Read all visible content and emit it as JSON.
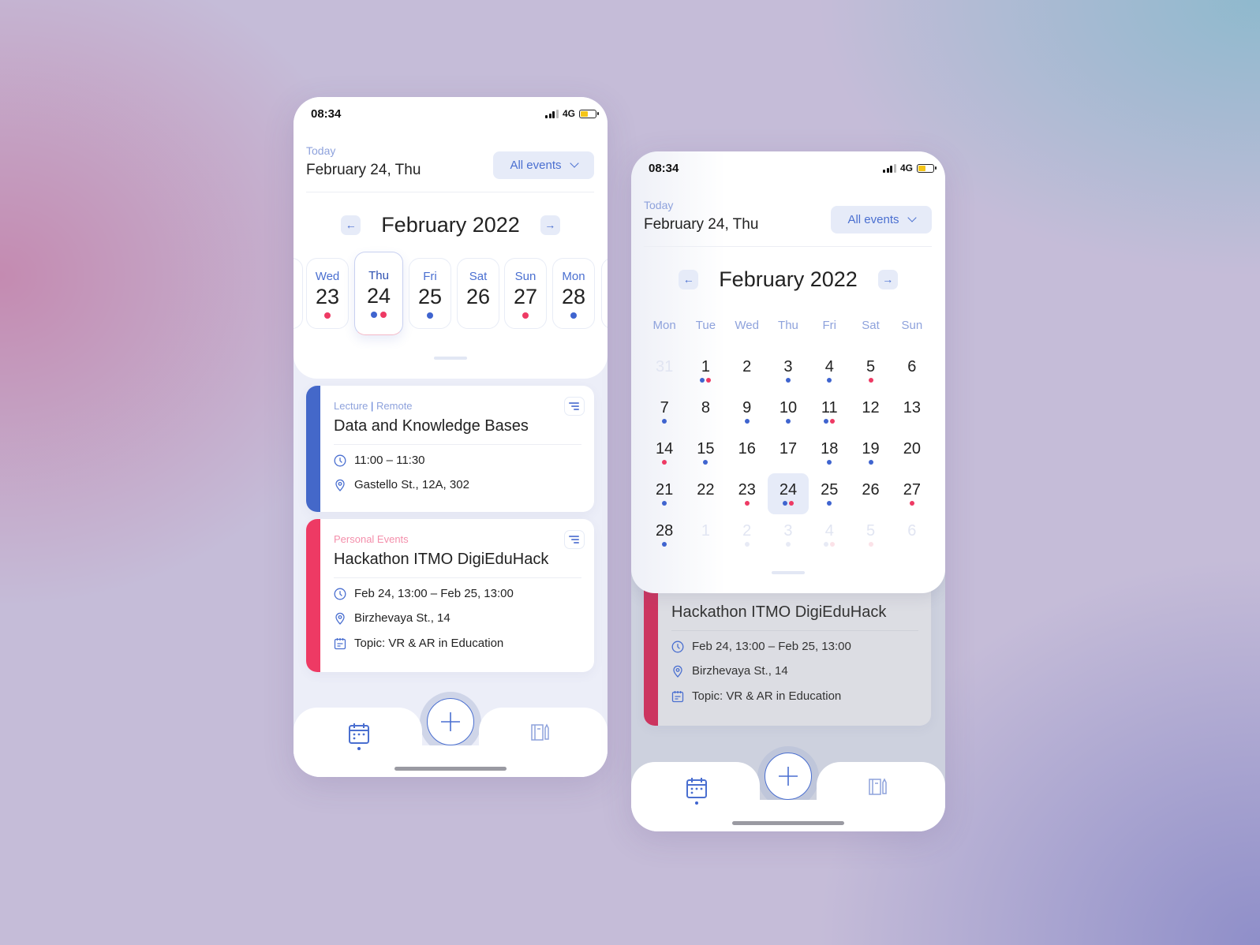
{
  "colors": {
    "accent_blue": "#3f64cf",
    "accent_red": "#ee3a64",
    "label_blue": "#8ea2dc",
    "chip_bg": "#e6ebf8",
    "battery_yellow": "#f5c518"
  },
  "status_bar": {
    "time": "08:34",
    "network": "4G",
    "signal_icon": "signal-bars-icon",
    "battery_icon": "battery-icon",
    "battery_level": 0.5
  },
  "header": {
    "today_label": "Today",
    "today_date": "February 24, Thu",
    "filter": {
      "label": "All events",
      "icon": "chevron-down-icon"
    }
  },
  "month_nav": {
    "title": "February 2022",
    "prev_icon": "arrow-left-icon",
    "next_icon": "arrow-right-icon"
  },
  "week_strip": {
    "days": [
      {
        "name": "Wed",
        "num": "23",
        "dots": [
          "red"
        ]
      },
      {
        "name": "Thu",
        "num": "24",
        "dots": [
          "blue",
          "red"
        ],
        "selected": true
      },
      {
        "name": "Fri",
        "num": "25",
        "dots": [
          "blue"
        ]
      },
      {
        "name": "Sat",
        "num": "26",
        "dots": []
      },
      {
        "name": "Sun",
        "num": "27",
        "dots": [
          "red"
        ]
      },
      {
        "name": "Mon",
        "num": "28",
        "dots": [
          "blue"
        ]
      }
    ]
  },
  "events": [
    {
      "category": "Lecture",
      "category_extra": "Remote",
      "category_color": "#8ea2dc",
      "bar_color": "#4468c9",
      "title": "Data and Knowledge Bases",
      "time": "11:00 – 11:30",
      "location": "Gastello St., 12A, 302"
    },
    {
      "category": "Personal Events",
      "category_color": "#f48fab",
      "bar_color": "#ee3a64",
      "title": "Hackathon ITMO DigiEduHack",
      "time": "Feb 24, 13:00 – Feb 25, 13:00",
      "location": "Birzhevaya St., 14",
      "topic": "Topic: VR & AR in Education"
    }
  ],
  "month_view": {
    "weekdays": [
      "Mon",
      "Tue",
      "Wed",
      "Thu",
      "Fri",
      "Sat",
      "Sun"
    ],
    "weeks": [
      [
        {
          "n": "31",
          "muted": true,
          "dots": []
        },
        {
          "n": "1",
          "dots": [
            "blue",
            "red"
          ]
        },
        {
          "n": "2",
          "dots": []
        },
        {
          "n": "3",
          "dots": [
            "blue"
          ]
        },
        {
          "n": "4",
          "dots": [
            "blue"
          ]
        },
        {
          "n": "5",
          "dots": [
            "red"
          ]
        },
        {
          "n": "6",
          "dots": []
        }
      ],
      [
        {
          "n": "7",
          "dots": [
            "blue"
          ]
        },
        {
          "n": "8",
          "dots": []
        },
        {
          "n": "9",
          "dots": [
            "blue"
          ]
        },
        {
          "n": "10",
          "dots": [
            "blue"
          ]
        },
        {
          "n": "11",
          "dots": [
            "blue",
            "red"
          ]
        },
        {
          "n": "12",
          "dots": []
        },
        {
          "n": "13",
          "dots": []
        }
      ],
      [
        {
          "n": "14",
          "dots": [
            "red"
          ]
        },
        {
          "n": "15",
          "dots": [
            "blue"
          ]
        },
        {
          "n": "16",
          "dots": []
        },
        {
          "n": "17",
          "dots": []
        },
        {
          "n": "18",
          "dots": [
            "blue"
          ]
        },
        {
          "n": "19",
          "dots": [
            "blue"
          ]
        },
        {
          "n": "20",
          "dots": []
        }
      ],
      [
        {
          "n": "21",
          "dots": [
            "blue"
          ]
        },
        {
          "n": "22",
          "dots": []
        },
        {
          "n": "23",
          "dots": [
            "red"
          ]
        },
        {
          "n": "24",
          "dots": [
            "blue",
            "red"
          ],
          "selected": true
        },
        {
          "n": "25",
          "dots": [
            "blue"
          ]
        },
        {
          "n": "26",
          "dots": []
        },
        {
          "n": "27",
          "dots": [
            "red"
          ]
        }
      ],
      [
        {
          "n": "28",
          "dots": [
            "blue"
          ]
        },
        {
          "n": "1",
          "muted": true,
          "dots": []
        },
        {
          "n": "2",
          "muted": true,
          "dots": [
            "blue"
          ]
        },
        {
          "n": "3",
          "muted": true,
          "dots": [
            "blue"
          ]
        },
        {
          "n": "4",
          "muted": true,
          "dots": [
            "blue",
            "red"
          ]
        },
        {
          "n": "5",
          "muted": true,
          "dots": [
            "red"
          ]
        },
        {
          "n": "6",
          "muted": true,
          "dots": []
        }
      ]
    ]
  },
  "bottom_nav": {
    "tabs": [
      {
        "name": "calendar",
        "icon": "calendar-icon",
        "active": true
      },
      {
        "name": "notes",
        "icon": "notebook-icon",
        "active": false
      }
    ],
    "add_icon": "plus-icon"
  }
}
